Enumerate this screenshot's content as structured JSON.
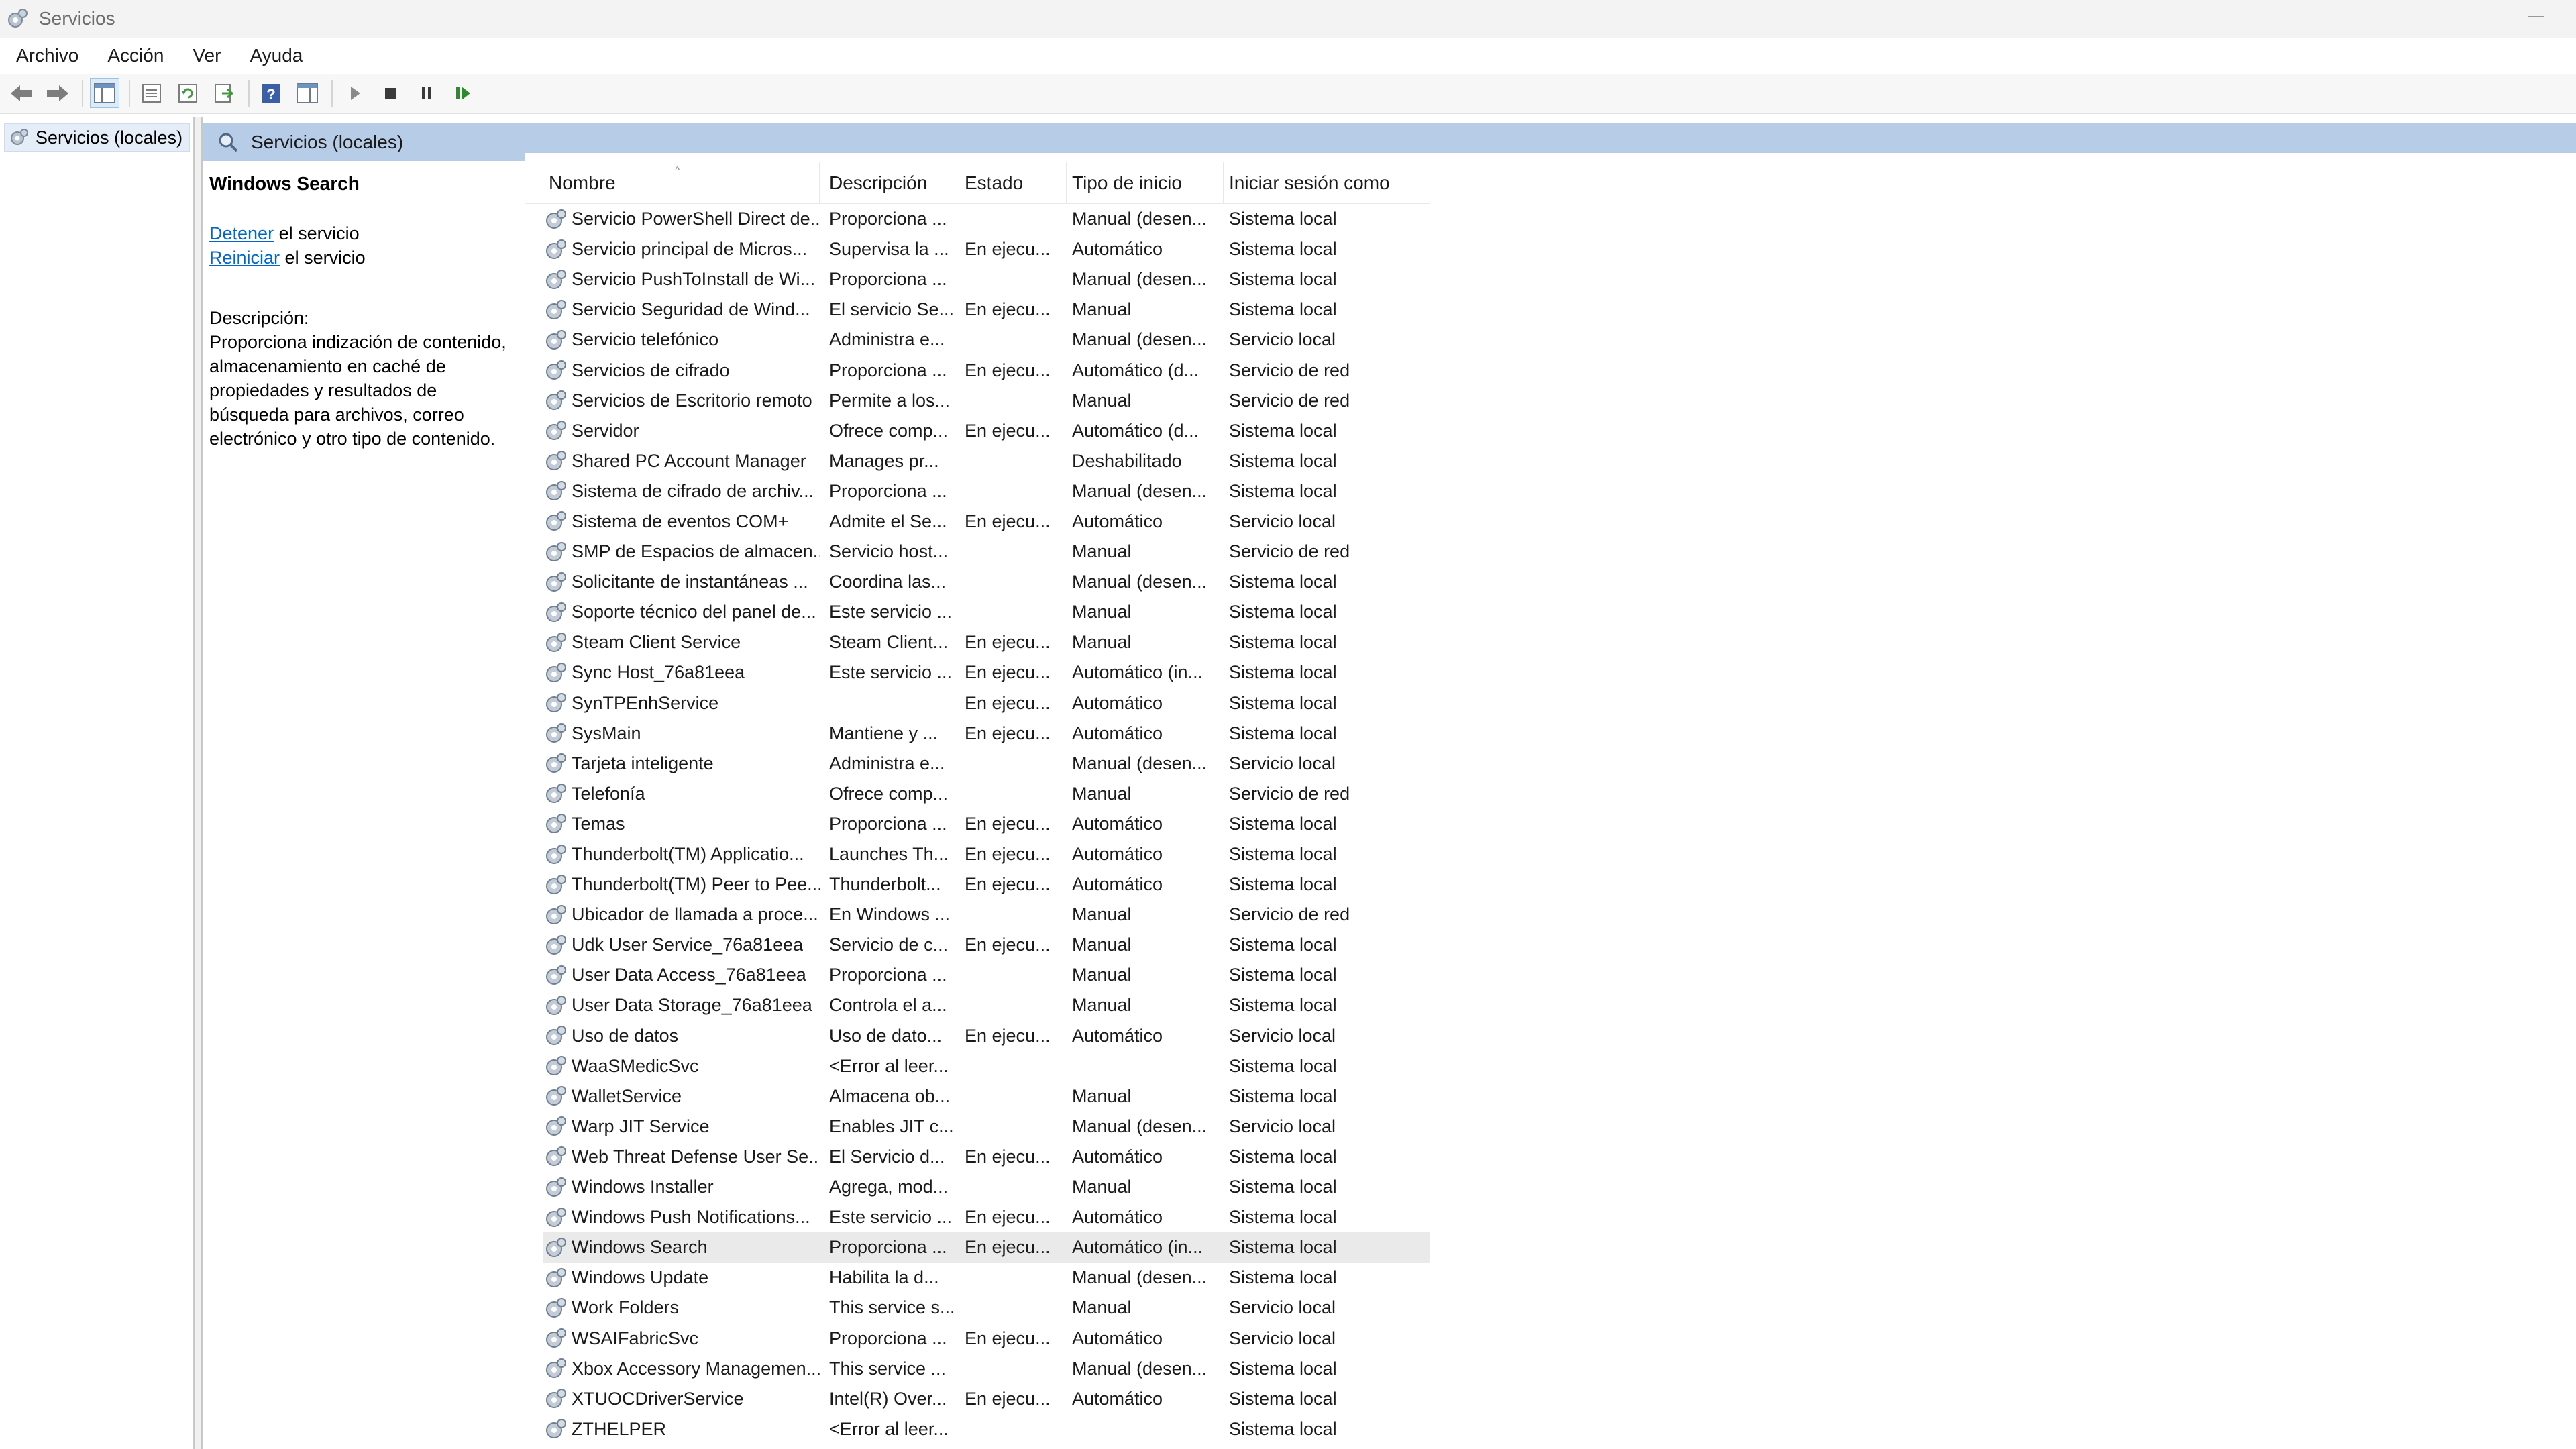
{
  "window": {
    "title": "Servicios"
  },
  "menu": [
    "Archivo",
    "Acción",
    "Ver",
    "Ayuda"
  ],
  "toolbar": {
    "buttons": [
      "back-icon",
      "forward-icon",
      "show-hide-console-tree-icon",
      "properties-icon",
      "refresh-icon",
      "export-list-icon",
      "help-icon",
      "show-action-pane-icon",
      "start-service-icon",
      "stop-service-icon",
      "pause-service-icon",
      "restart-service-icon"
    ]
  },
  "tree": {
    "item": "Servicios (locales)"
  },
  "content": {
    "header": "Servicios (locales)"
  },
  "details": {
    "service_name": "Windows Search",
    "action1_link": "Detener",
    "action1_rest": " el servicio",
    "action2_link": "Reiniciar",
    "action2_rest": " el servicio",
    "desc_label": "Descripción:",
    "desc_text": "Proporciona indización de contenido, almacenamiento en caché de propiedades y resultados de búsqueda para archivos, correo electrónico y otro tipo de contenido."
  },
  "columns": [
    "Nombre",
    "Descripción",
    "Estado",
    "Tipo de inicio",
    "Iniciar sesión como"
  ],
  "rows": [
    [
      "Servicio PowerShell Direct de...",
      "Proporciona ...",
      "",
      "Manual (desen...",
      "Sistema local"
    ],
    [
      "Servicio principal de Micros...",
      "Supervisa la ...",
      "En ejecu...",
      "Automático",
      "Sistema local"
    ],
    [
      "Servicio PushToInstall de Wi...",
      "Proporciona ...",
      "",
      "Manual (desen...",
      "Sistema local"
    ],
    [
      "Servicio Seguridad de Wind...",
      "El servicio Se...",
      "En ejecu...",
      "Manual",
      "Sistema local"
    ],
    [
      "Servicio telefónico",
      "Administra e...",
      "",
      "Manual (desen...",
      "Servicio local"
    ],
    [
      "Servicios de cifrado",
      "Proporciona ...",
      "En ejecu...",
      "Automático (d...",
      "Servicio de red"
    ],
    [
      "Servicios de Escritorio remoto",
      "Permite a los...",
      "",
      "Manual",
      "Servicio de red"
    ],
    [
      "Servidor",
      "Ofrece comp...",
      "En ejecu...",
      "Automático (d...",
      "Sistema local"
    ],
    [
      "Shared PC Account Manager",
      "Manages pr...",
      "",
      "Deshabilitado",
      "Sistema local"
    ],
    [
      "Sistema de cifrado de archiv...",
      "Proporciona ...",
      "",
      "Manual (desen...",
      "Sistema local"
    ],
    [
      "Sistema de eventos COM+",
      "Admite el Se...",
      "En ejecu...",
      "Automático",
      "Servicio local"
    ],
    [
      "SMP de Espacios de almacen...",
      "Servicio host...",
      "",
      "Manual",
      "Servicio de red"
    ],
    [
      "Solicitante de instantáneas ...",
      "Coordina las...",
      "",
      "Manual (desen...",
      "Sistema local"
    ],
    [
      "Soporte técnico del panel de...",
      "Este servicio ...",
      "",
      "Manual",
      "Sistema local"
    ],
    [
      "Steam Client Service",
      "Steam Client...",
      "En ejecu...",
      "Manual",
      "Sistema local"
    ],
    [
      "Sync Host_76a81eea",
      "Este servicio ...",
      "En ejecu...",
      "Automático (in...",
      "Sistema local"
    ],
    [
      "SynTPEnhService",
      "",
      "En ejecu...",
      "Automático",
      "Sistema local"
    ],
    [
      "SysMain",
      "Mantiene y ...",
      "En ejecu...",
      "Automático",
      "Sistema local"
    ],
    [
      "Tarjeta inteligente",
      "Administra e...",
      "",
      "Manual (desen...",
      "Servicio local"
    ],
    [
      "Telefonía",
      "Ofrece comp...",
      "",
      "Manual",
      "Servicio de red"
    ],
    [
      "Temas",
      "Proporciona ...",
      "En ejecu...",
      "Automático",
      "Sistema local"
    ],
    [
      "Thunderbolt(TM) Applicatio...",
      "Launches Th...",
      "En ejecu...",
      "Automático",
      "Sistema local"
    ],
    [
      "Thunderbolt(TM) Peer to Pee...",
      "Thunderbolt...",
      "En ejecu...",
      "Automático",
      "Sistema local"
    ],
    [
      "Ubicador de llamada a proce...",
      "En Windows ...",
      "",
      "Manual",
      "Servicio de red"
    ],
    [
      "Udk User Service_76a81eea",
      "Servicio de c...",
      "En ejecu...",
      "Manual",
      "Sistema local"
    ],
    [
      "User Data Access_76a81eea",
      "Proporciona ...",
      "",
      "Manual",
      "Sistema local"
    ],
    [
      "User Data Storage_76a81eea",
      "Controla el a...",
      "",
      "Manual",
      "Sistema local"
    ],
    [
      "Uso de datos",
      "Uso de dato...",
      "En ejecu...",
      "Automático",
      "Servicio local"
    ],
    [
      "WaaSMedicSvc",
      "<Error al leer...",
      "",
      "",
      "Sistema local"
    ],
    [
      "WalletService",
      "Almacena ob...",
      "",
      "Manual",
      "Sistema local"
    ],
    [
      "Warp JIT Service",
      "Enables JIT c...",
      "",
      "Manual (desen...",
      "Servicio local"
    ],
    [
      "Web Threat Defense User Se...",
      "El Servicio d...",
      "En ejecu...",
      "Automático",
      "Sistema local"
    ],
    [
      "Windows Installer",
      "Agrega, mod...",
      "",
      "Manual",
      "Sistema local"
    ],
    [
      "Windows Push Notifications...",
      "Este servicio ...",
      "En ejecu...",
      "Automático",
      "Sistema local"
    ],
    [
      "Windows Search",
      "Proporciona ...",
      "En ejecu...",
      "Automático (in...",
      "Sistema local"
    ],
    [
      "Windows Update",
      "Habilita la d...",
      "",
      "Manual (desen...",
      "Sistema local"
    ],
    [
      "Work Folders",
      "This service s...",
      "",
      "Manual",
      "Servicio local"
    ],
    [
      "WSAIFabricSvc",
      "Proporciona ...",
      "En ejecu...",
      "Automático",
      "Servicio local"
    ],
    [
      "Xbox Accessory Managemen...",
      "This service ...",
      "",
      "Manual (desen...",
      "Sistema local"
    ],
    [
      "XTUOCDriverService",
      "Intel(R) Over...",
      "En ejecu...",
      "Automático",
      "Sistema local"
    ],
    [
      "ZTHELPER",
      "<Error al leer...",
      "",
      "",
      "Sistema local"
    ]
  ],
  "selected_row": "Windows Search"
}
